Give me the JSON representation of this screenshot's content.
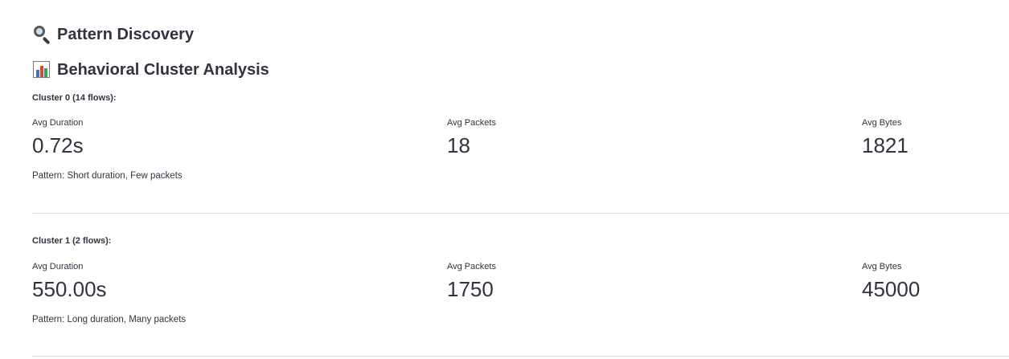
{
  "headings": {
    "pattern_discovery": "Pattern Discovery",
    "behavioral_cluster_analysis": "Behavioral Cluster Analysis"
  },
  "icons": {
    "pattern_discovery": "magnifying-glass-icon",
    "behavioral_cluster_analysis": "bar-chart-icon"
  },
  "clusters": [
    {
      "label": "Cluster 0 (14 flows):",
      "metrics": {
        "duration_label": "Avg Duration",
        "duration_value": "0.72s",
        "packets_label": "Avg Packets",
        "packets_value": "18",
        "bytes_label": "Avg Bytes",
        "bytes_value": "1821"
      },
      "pattern": "Pattern: Short duration, Few packets"
    },
    {
      "label": "Cluster 1 (2 flows):",
      "metrics": {
        "duration_label": "Avg Duration",
        "duration_value": "550.00s",
        "packets_label": "Avg Packets",
        "packets_value": "1750",
        "bytes_label": "Avg Bytes",
        "bytes_value": "45000"
      },
      "pattern": "Pattern: Long duration, Many packets"
    }
  ],
  "colors": {
    "text": "#31333f",
    "divider": "#d9d9de",
    "bar_chart_bars": [
      "#2e7bd6",
      "#e0433b",
      "#3aa654"
    ]
  }
}
